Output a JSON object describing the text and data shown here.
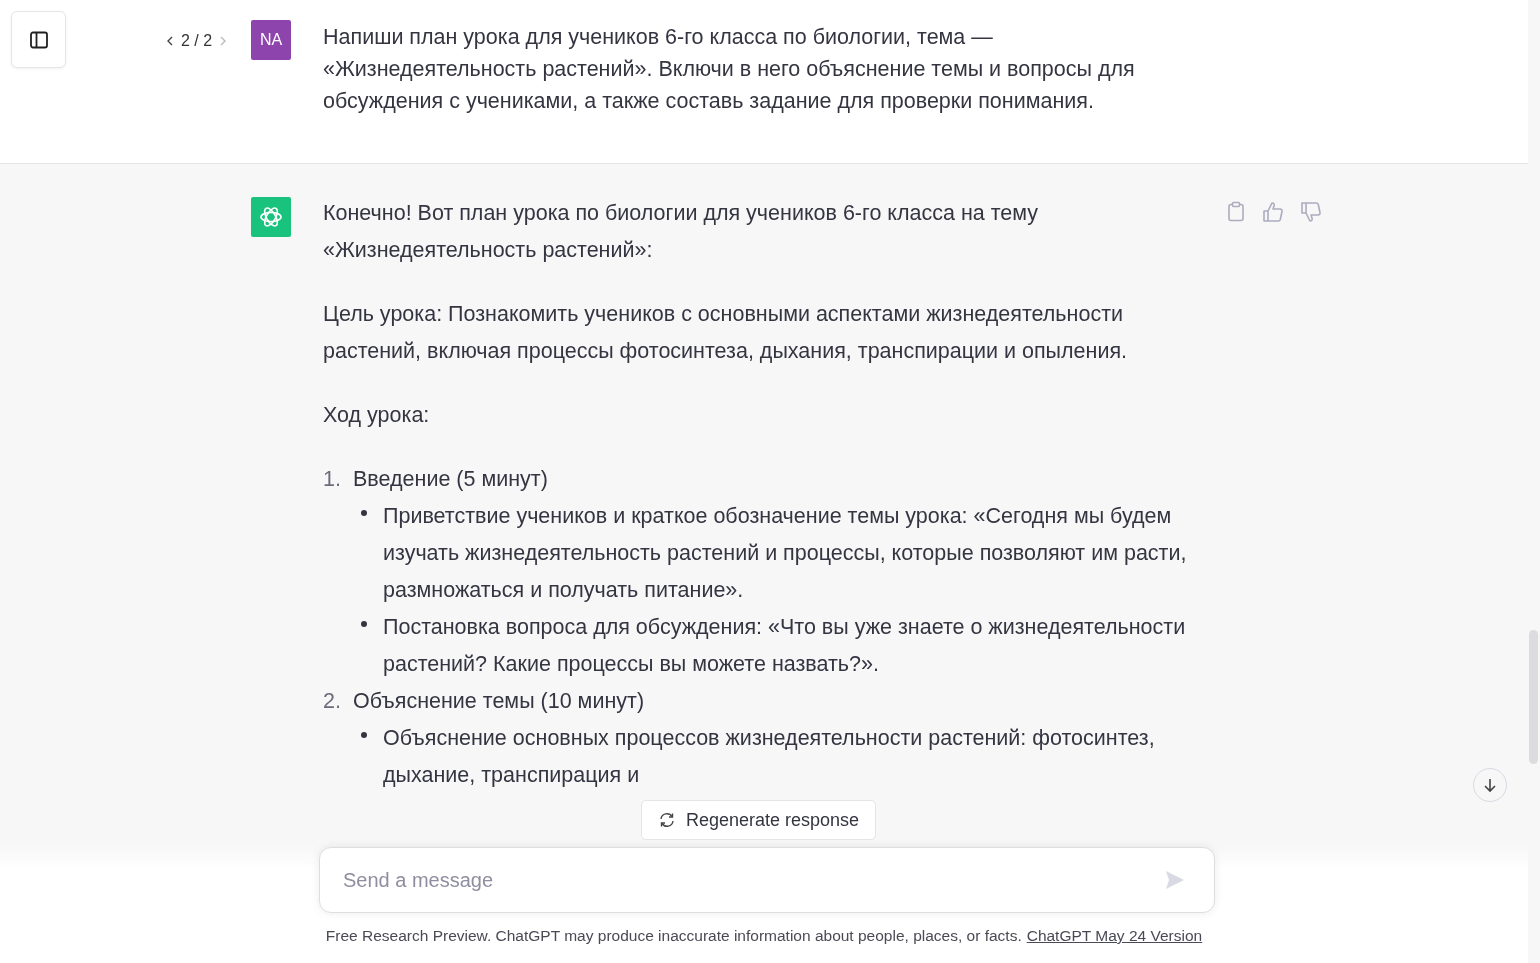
{
  "user_message": {
    "pager": "2 / 2",
    "avatar": "NA",
    "text": "Напиши план урока для учеников 6-го класса по биологии, тема — «Жизнедеятельность растений». Включи в него объяснение темы и вопросы для обсуждения с учениками, а также составь задание для проверки понимания."
  },
  "assistant_message": {
    "paragraphs": [
      "Конечно! Вот план урока по биологии для учеников 6-го класса на тему «Жизнедеятельность растений»:",
      "Цель урока: Познакомить учеников с основными аспектами жизнедеятельности растений, включая процессы фотосинтеза, дыхания, транспирации и опыления.",
      "Ход урока:"
    ],
    "steps": [
      {
        "number": "1.",
        "title": "Введение (5 минут)",
        "bullets": [
          "Приветствие учеников и краткое обозначение темы урока: «Сегодня мы будем изучать жизнедеятельность растений и процессы, которые позволяют им расти, размножаться и получать питание».",
          "Постановка вопроса для обсуждения: «Что вы уже знаете о жизнедеятельности растений? Какие процессы вы можете назвать?»."
        ]
      },
      {
        "number": "2.",
        "title": "Объяснение темы (10 минут)",
        "bullets": [
          "Объяснение основных процессов жизнедеятельности растений: фотосинтез, дыхание, транспирация и"
        ]
      }
    ]
  },
  "regenerate_button": "Regenerate response",
  "composer": {
    "placeholder": "Send a message"
  },
  "footer": {
    "text": "Free Research Preview. ChatGPT may produce inaccurate information about people, places, or facts.",
    "link": "ChatGPT May 24 Version"
  }
}
